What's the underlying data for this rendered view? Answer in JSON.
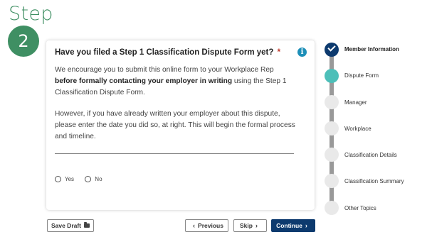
{
  "step": {
    "label": "Step",
    "number": "2"
  },
  "form": {
    "question": "Have you filed a Step 1 Classification Dispute Form yet?",
    "required_marker": "*",
    "info_icon": "info-icon",
    "para1_pre": "We encourage you to submit this online form to your Workplace Rep ",
    "para1_bold": "before formally contacting your employer in writing",
    "para1_post": " using the Step 1 Classification Dispute Form.",
    "para2": "However, if you have already written your employer about this dispute, please enter the date you did so, at right. This will begin the formal process and timeline.",
    "options": [
      "Yes",
      "No"
    ]
  },
  "buttons": {
    "save_draft": "Save Draft",
    "previous": "Previous",
    "skip": "Skip",
    "continue": "Continue"
  },
  "steps": [
    {
      "label": "Member Information",
      "state": "done"
    },
    {
      "label": "Dispute Form",
      "state": "active"
    },
    {
      "label": "Manager",
      "state": "todo"
    },
    {
      "label": "Workplace",
      "state": "todo"
    },
    {
      "label": "Classification Details",
      "state": "todo"
    },
    {
      "label": "Classification Summary",
      "state": "todo"
    },
    {
      "label": "Other Topics",
      "state": "todo"
    }
  ],
  "colors": {
    "brand_green": "#3f8f63",
    "navy": "#0d3a6e",
    "teal": "#4dbfb9",
    "info_blue": "#1d8fb8",
    "required_red": "#c0392b"
  }
}
